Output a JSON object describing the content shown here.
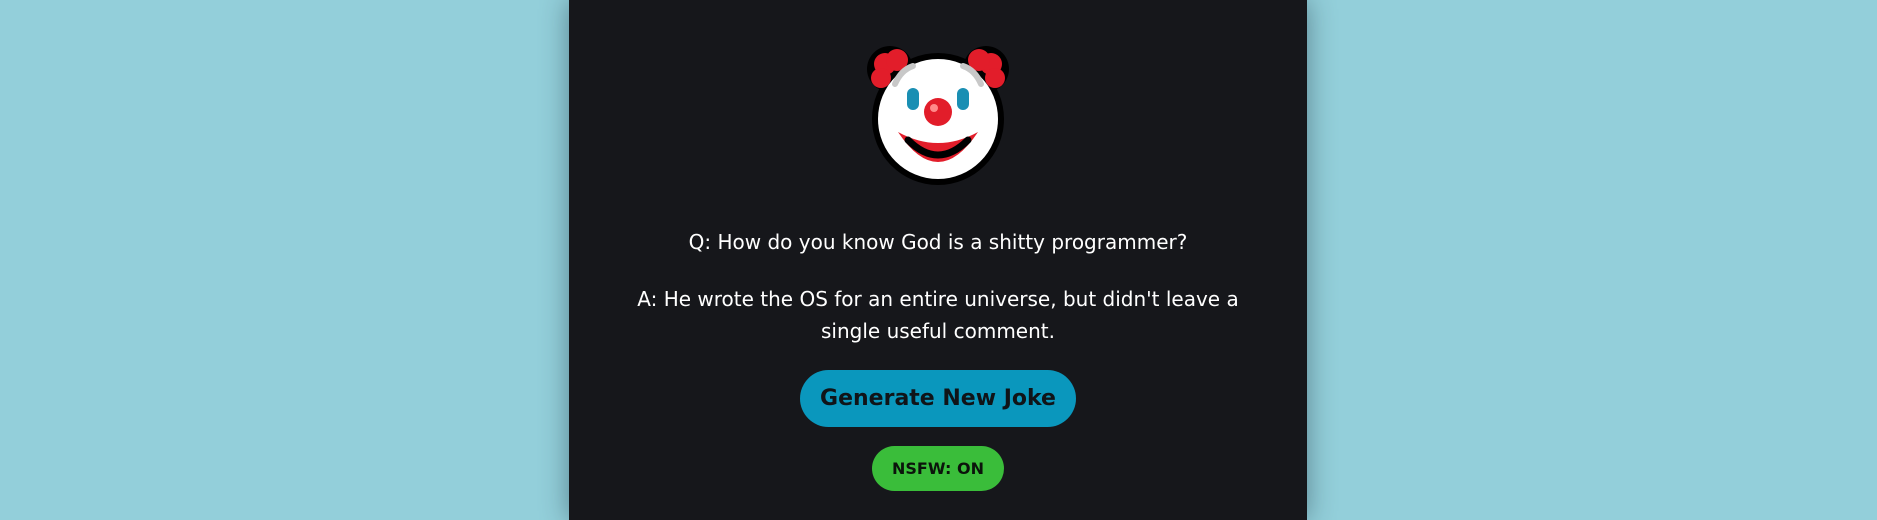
{
  "joke": {
    "icon": "clown-face-icon",
    "question": "Q: How do you know God is a shitty programmer?",
    "answer": "A: He wrote the OS for an entire universe, but didn't leave a single useful comment."
  },
  "controls": {
    "generate_label": "Generate New Joke",
    "nsfw_label": "NSFW: ON"
  },
  "colors": {
    "background": "#93cfda",
    "card": "#16171b",
    "generate_button": "#0a97bd",
    "nsfw_button": "#3abd3a"
  }
}
